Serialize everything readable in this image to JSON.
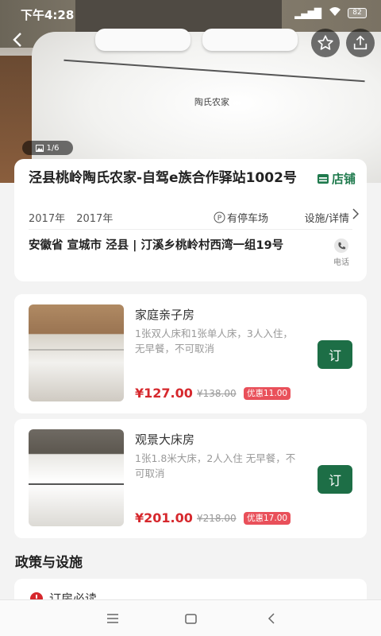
{
  "status": {
    "time": "下午4:28",
    "battery": "82"
  },
  "gallery": {
    "counter": "1/6",
    "bed_embroidery": "陶氏农家"
  },
  "hotel": {
    "name": "泾县桃岭陶氏农家-自驾e族合作驿站1002号",
    "store_label": "店铺",
    "years": [
      "2017年",
      "2017年"
    ],
    "parking": "有停车场",
    "facilities_link": "设施/详情",
    "address": "安徽省 宣城市 泾县 | 汀溪乡桃岭村西湾一组19号",
    "phone_label": "电话"
  },
  "rooms": [
    {
      "name": "家庭亲子房",
      "desc": "1张双人床和1张单人床，3人入住，无早餐，不可取消",
      "price": "¥127.00",
      "original_price": "¥138.00",
      "discount": "优惠11.00",
      "book_label": "订"
    },
    {
      "name": "观景大床房",
      "desc": "1张1.8米大床，2人入住 无早餐，不可取消",
      "price": "¥201.00",
      "original_price": "¥218.00",
      "discount": "优惠17.00",
      "book_label": "订"
    }
  ],
  "policy": {
    "section_title": "政策与设施",
    "first_item": "订房必读"
  },
  "colors": {
    "brand_green": "#1d6e46",
    "price_red": "#d6282d",
    "discount_bg": "#e9505a"
  }
}
